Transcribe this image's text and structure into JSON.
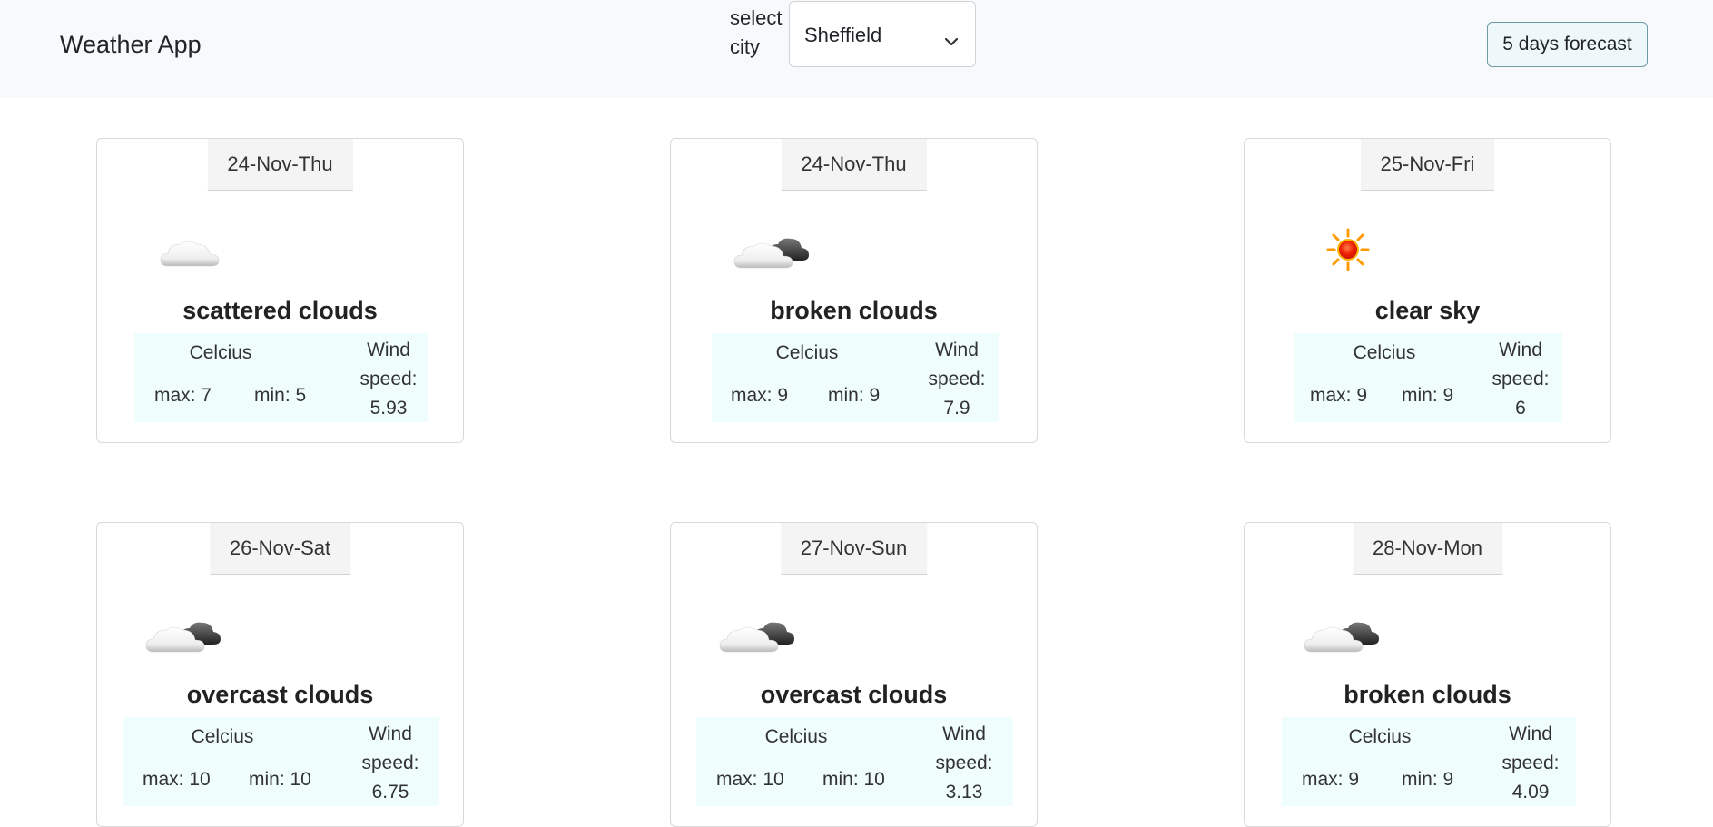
{
  "app": {
    "title": "Weather App",
    "select_label": "select city",
    "selected_city": "Sheffield",
    "forecast_button": "5 days forecast"
  },
  "cards": [
    {
      "date": "24-Nov-Thu",
      "description": "scattered clouds",
      "icon": "scattered-clouds-icon",
      "unit": "Celcius",
      "max": "max: 7",
      "min": "min: 5",
      "wind_label_1": "Wind",
      "wind_label_2": "speed:",
      "wind": "5.93"
    },
    {
      "date": "24-Nov-Thu",
      "description": "broken clouds",
      "icon": "broken-clouds-icon",
      "unit": "Celcius",
      "max": "max: 9",
      "min": "min: 9",
      "wind_label_1": "Wind",
      "wind_label_2": "speed:",
      "wind": "7.9"
    },
    {
      "date": "25-Nov-Fri",
      "description": "clear sky",
      "icon": "sun-icon",
      "unit": "Celcius",
      "max": "max: 9",
      "min": "min: 9",
      "wind_label_1": "Wind",
      "wind_label_2": "speed:",
      "wind": "6"
    },
    {
      "date": "26-Nov-Sat",
      "description": "overcast clouds",
      "icon": "overcast-clouds-icon",
      "unit": "Celcius",
      "max": "max: 10",
      "min": "min: 10",
      "wind_label_1": "Wind",
      "wind_label_2": "speed:",
      "wind": "6.75"
    },
    {
      "date": "27-Nov-Sun",
      "description": "overcast clouds",
      "icon": "overcast-clouds-icon",
      "unit": "Celcius",
      "max": "max: 10",
      "min": "min: 10",
      "wind_label_1": "Wind",
      "wind_label_2": "speed:",
      "wind": "3.13"
    },
    {
      "date": "28-Nov-Mon",
      "description": "broken clouds",
      "icon": "broken-clouds-icon",
      "unit": "Celcius",
      "max": "max: 9",
      "min": "min: 9",
      "wind_label_1": "Wind",
      "wind_label_2": "speed:",
      "wind": "4.09"
    }
  ]
}
